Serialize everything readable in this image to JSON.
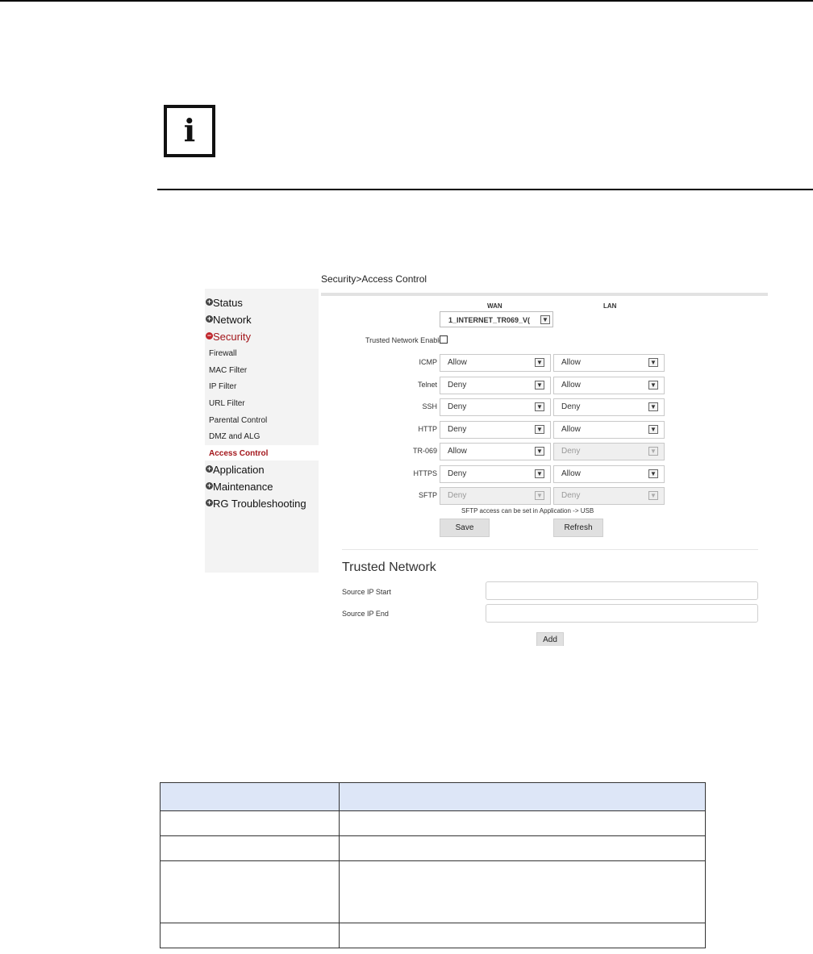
{
  "note": {
    "icon": "info-icon",
    "glyph": "i"
  },
  "sidebar": {
    "top_items": [
      {
        "label": "Status",
        "state": "collapsed"
      },
      {
        "label": "Network",
        "state": "collapsed"
      },
      {
        "label": "Security",
        "state": "expanded"
      },
      {
        "label": "Application",
        "state": "collapsed"
      },
      {
        "label": "Maintenance",
        "state": "collapsed"
      },
      {
        "label": "RG Troubleshooting",
        "state": "collapsed"
      }
    ],
    "sub_items": [
      "Firewall",
      "MAC Filter",
      "IP Filter",
      "URL Filter",
      "Parental Control",
      "DMZ and ALG",
      "Access Control"
    ],
    "active_sub_item": "Access Control",
    "active_color": "#a3161b"
  },
  "breadcrumb": "Security>Access Control",
  "columns": {
    "wan": "WAN",
    "lan": "LAN"
  },
  "wan_interface": {
    "value": "1_INTERNET_TR069_V("
  },
  "trusted_network_enable": {
    "label": "Trusted Network Enable",
    "checked": false
  },
  "services": [
    {
      "name": "ICMP",
      "wan": "Allow",
      "lan": "Allow",
      "wan_disabled": false,
      "lan_disabled": false
    },
    {
      "name": "Telnet",
      "wan": "Deny",
      "lan": "Allow",
      "wan_disabled": false,
      "lan_disabled": false
    },
    {
      "name": "SSH",
      "wan": "Deny",
      "lan": "Deny",
      "wan_disabled": false,
      "lan_disabled": false
    },
    {
      "name": "HTTP",
      "wan": "Deny",
      "lan": "Allow",
      "wan_disabled": false,
      "lan_disabled": false
    },
    {
      "name": "TR-069",
      "wan": "Allow",
      "lan": "Deny",
      "wan_disabled": false,
      "lan_disabled": true
    },
    {
      "name": "HTTPS",
      "wan": "Deny",
      "lan": "Allow",
      "wan_disabled": false,
      "lan_disabled": false
    },
    {
      "name": "SFTP",
      "wan": "Deny",
      "lan": "Deny",
      "wan_disabled": true,
      "lan_disabled": true
    }
  ],
  "sftp_note": "SFTP access can be set in Application -> USB",
  "buttons": {
    "save": "Save",
    "refresh": "Refresh",
    "add": "Add"
  },
  "trusted_network": {
    "title": "Trusted Network",
    "source_ip_start": {
      "label": "Source IP Start",
      "value": ""
    },
    "source_ip_end": {
      "label": "Source IP End",
      "value": ""
    }
  },
  "table": {
    "header_color": "#dde6f7",
    "rows": 4
  }
}
